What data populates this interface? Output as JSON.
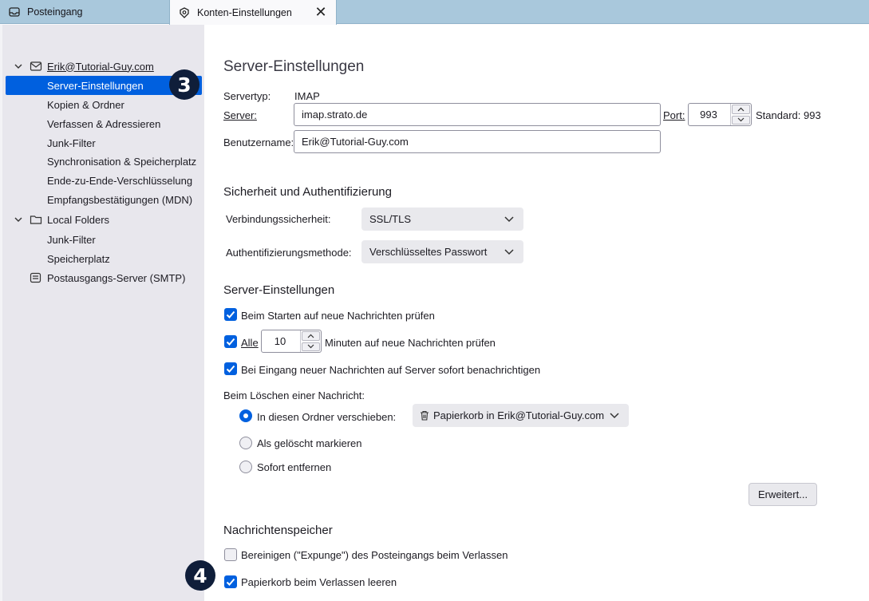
{
  "tabs": {
    "inbox_label": "Posteingang",
    "settings_label": "Konten-Einstellungen",
    "close_symbol": "✕"
  },
  "sidebar": {
    "account": "Erik@Tutorial-Guy.com",
    "items": [
      "Server-Einstellungen",
      "Kopien & Ordner",
      "Verfassen & Adressieren",
      "Junk-Filter",
      "Synchronisation & Speicherplatz",
      "Ende-zu-Ende-Verschlüsselung",
      "Empfangsbestätigungen (MDN)"
    ],
    "local_folders": "Local Folders",
    "local_items": [
      "Junk-Filter",
      "Speicherplatz"
    ],
    "smtp": "Postausgangs-Server (SMTP)",
    "badge3": "3"
  },
  "server": {
    "title": "Server-Einstellungen",
    "servertype_label": "Servertyp:",
    "servertype_value": "IMAP",
    "server_label": "Server:",
    "server_value": "imap.strato.de",
    "port_label": "Port:",
    "port_value": "993",
    "standard_label": "Standard: 993",
    "username_label": "Benutzername:",
    "username_value": "Erik@Tutorial-Guy.com"
  },
  "security": {
    "title": "Sicherheit und Authentifizierung",
    "conn_label": "Verbindungssicherheit:",
    "conn_value": "SSL/TLS",
    "auth_label": "Authentifizierungsmethode:",
    "auth_value": "Verschlüsseltes Passwort"
  },
  "server_settings": {
    "title": "Server-Einstellungen",
    "check_startup": "Beim Starten auf neue Nachrichten prüfen",
    "check_every_prefix": "Alle",
    "check_every_value": "10",
    "check_every_suffix": "Minuten auf neue Nachrichten prüfen",
    "notify": "Bei Eingang neuer Nachrichten auf Server sofort benachrichtigen",
    "delete_label": "Beim Löschen einer Nachricht:",
    "move_to": "In diesen Ordner verschieben:",
    "trash_folder": "Papierkorb in Erik@Tutorial-Guy.com",
    "mark_deleted": "Als gelöscht markieren",
    "remove_now": "Sofort entfernen",
    "advanced_button": "Erweitert..."
  },
  "storage": {
    "title": "Nachrichtenspeicher",
    "expunge": "Bereinigen (\"Expunge\") des Posteingangs beim Verlassen",
    "empty_trash": "Papierkorb beim Verlassen leeren",
    "badge4": "4"
  },
  "colors": {
    "accent": "#0060df",
    "tabbar": "#a9c8dc",
    "sidebar": "#e8e7ed",
    "badge": "#0f1e3a"
  }
}
